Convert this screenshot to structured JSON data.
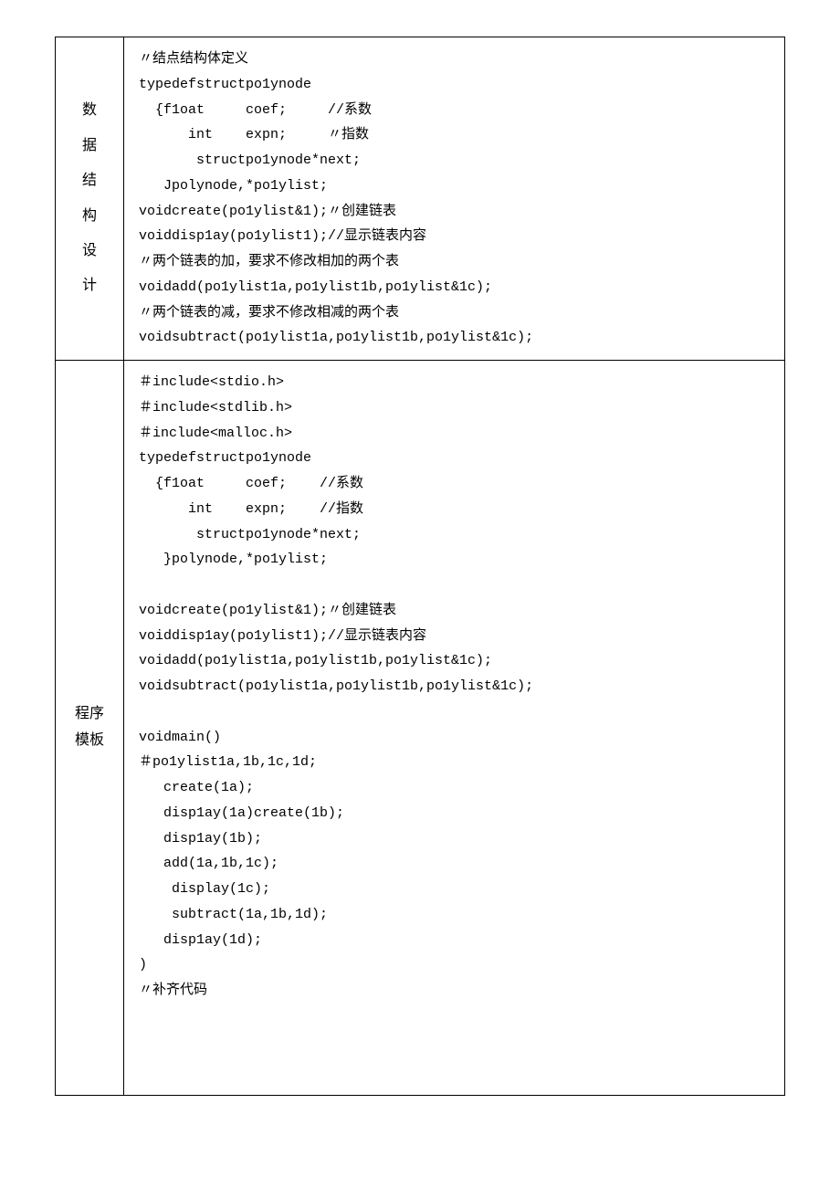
{
  "row1": {
    "label_chars": [
      "数",
      "据",
      "结",
      "构",
      "设",
      "计"
    ],
    "lines": [
      "〃结点结构体定义",
      "typedefstructpo1ynode",
      "  {f1oat     coef;     //系数",
      "      int    expn;     〃指数",
      "       structpo1ynode*next;",
      "   Jpolynode,*po1ylist;",
      "voidcreate(po1ylist&1);〃创建链表",
      "voiddisp1ay(po1ylist1);//显示链表内容",
      "〃两个链表的加，要求不修改相加的两个表",
      "voidadd(po1ylist1a,po1ylist1b,po1ylist&1c);",
      "〃两个链表的减，要求不修改相减的两个表",
      "voidsubtract(po1ylist1a,po1ylist1b,po1ylist&1c);"
    ]
  },
  "row2": {
    "label_chars": [
      "程序",
      "模板"
    ],
    "lines": [
      "＃include<stdio.h>",
      "＃include<stdlib.h>",
      "＃include<malloc.h>",
      "typedefstructpo1ynode",
      "  {f1oat     coef;    //系数",
      "      int    expn;    //指数",
      "       structpo1ynode*next;",
      "   }polynode,*po1ylist;",
      "",
      "voidcreate(po1ylist&1);〃创建链表",
      "voiddisp1ay(po1ylist1);//显示链表内容",
      "voidadd(po1ylist1a,po1ylist1b,po1ylist&1c);",
      "voidsubtract(po1ylist1a,po1ylist1b,po1ylist&1c);",
      "",
      "voidmain()",
      "＃po1ylist1a,1b,1c,1d;",
      "   create(1a);",
      "   disp1ay(1a)create(1b);",
      "   disp1ay(1b);",
      "   add(1a,1b,1c);",
      "    display(1c);",
      "    subtract(1a,1b,1d);",
      "   disp1ay(1d);",
      ")",
      "〃补齐代码"
    ]
  }
}
